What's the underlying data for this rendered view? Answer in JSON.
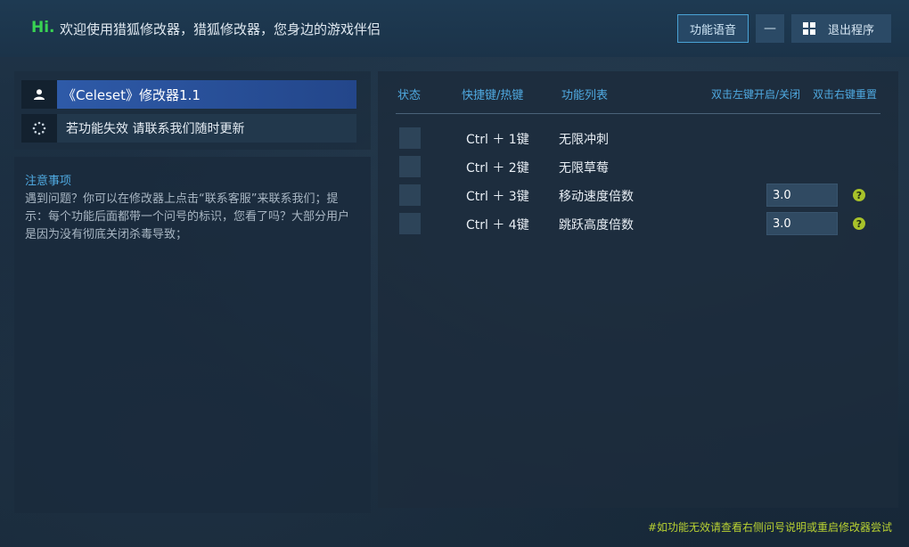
{
  "header": {
    "hi": "Hi.",
    "welcome": "欢迎使用猎狐修改器，猎狐修改器，您身边的游戏伴侣",
    "voice_button": "功能语音",
    "minimize_button": "—",
    "exit_button": "退出程序"
  },
  "left": {
    "game_title": "《Celeset》修改器1.1",
    "notice": "若功能失效  请联系我们随时更新",
    "note_title": "注意事项",
    "note_body": "遇到问题？你可以在修改器上点击“联系客服”来联系我们；提示：每个功能后面都带一个问号的标识，您看了吗？大部分用户是因为没有彻底关闭杀毒导致；"
  },
  "table": {
    "headers": {
      "status": "状态",
      "hotkey": "快捷键/热键",
      "function": "功能列表",
      "toggle_hint": "双击左键开启/关闭",
      "reset_hint": "双击右键重置"
    },
    "rows": [
      {
        "hotkey": "Ctrl ＋ 1键",
        "function": "无限冲刺"
      },
      {
        "hotkey": "Ctrl ＋ 2键",
        "function": "无限草莓"
      },
      {
        "hotkey": "Ctrl ＋ 3键",
        "function": "移动速度倍数",
        "value": "3.0",
        "help": "?"
      },
      {
        "hotkey": "Ctrl ＋ 4键",
        "function": "跳跃高度倍数",
        "value": "3.0",
        "help": "?"
      }
    ]
  },
  "footer": "#如功能无效请查看右侧问号说明或重启修改器尝试",
  "colors": {
    "accent": "#4fa9e0",
    "hi_green": "#39d353",
    "footer_yellow": "#b8d132",
    "selected_blue": "#2e5aa8"
  }
}
